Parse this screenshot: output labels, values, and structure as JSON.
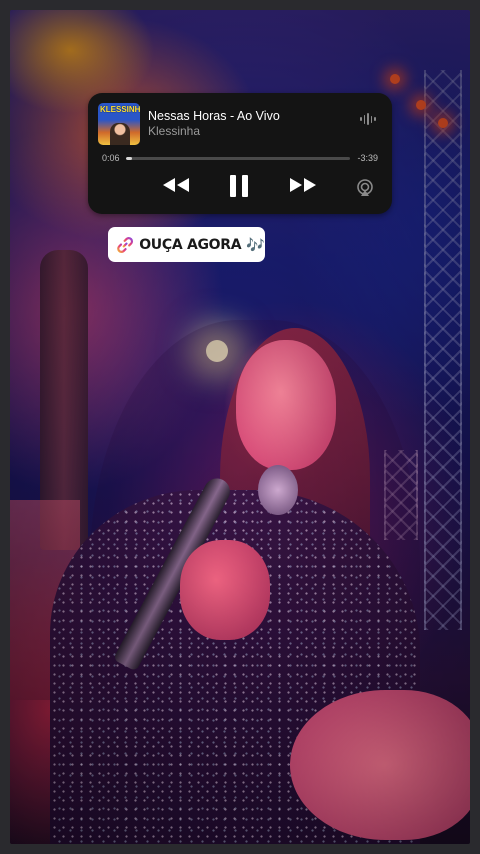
{
  "player": {
    "track_title": "Nessas Horas - Ao Vivo",
    "artist": "Klessinha",
    "cover_text": "KLESSINHA",
    "time_current": "0:06",
    "time_remaining": "-3:39",
    "progress": 0.027,
    "controls": {
      "rewind_icon": "rewind-icon",
      "pause_icon": "pause-icon",
      "forward_icon": "fast-forward-icon",
      "airplay_icon": "airplay-icon",
      "wave_icon": "audio-wave-icon"
    }
  },
  "sticker": {
    "label": "OUÇA AGORA",
    "notes": "🎶",
    "link_icon": "link-icon",
    "link_gradient": [
      "#f2b23a",
      "#e8407a",
      "#8a4ae0"
    ]
  },
  "colors": {
    "player_bg": "#141414",
    "artist_gray": "#9a9a9a"
  }
}
